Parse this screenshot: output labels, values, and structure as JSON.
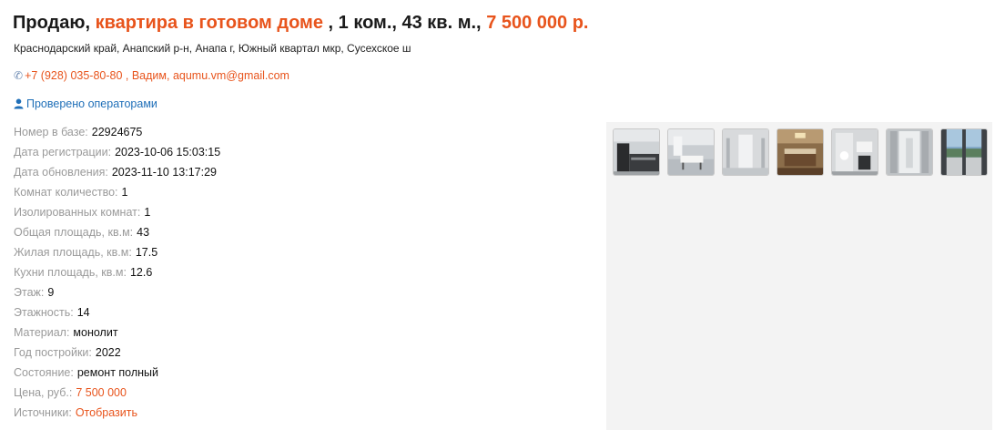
{
  "listing": {
    "title_prefix": "Продаю,",
    "title_type": "квартира в готовом доме",
    "title_rooms": "1 ком., 43 кв. м.,",
    "title_price": "7 500 000 р.",
    "address": "Краснодарский край, Анапский р-н, Анапа г, Южный квартал мкр, Сусехское ш",
    "contact": "+7 (928) 035-80-80 , Вадим, aqumu.vm@gmail.com",
    "verified": "Проверено операторами"
  },
  "properties": [
    {
      "label": "Номер в базе:",
      "value": "22924675"
    },
    {
      "label": "Дата регистрации:",
      "value": "2023-10-06 15:03:15"
    },
    {
      "label": "Дата обновления:",
      "value": "2023-11-10 13:17:29"
    },
    {
      "label": "Комнат количество:",
      "value": "1"
    },
    {
      "label": "Изолированных комнат:",
      "value": "1"
    },
    {
      "label": "Общая площадь, кв.м:",
      "value": "43"
    },
    {
      "label": "Жилая площадь, кв.м:",
      "value": "17.5"
    },
    {
      "label": "Кухни площадь, кв.м:",
      "value": "12.6"
    },
    {
      "label": "Этаж:",
      "value": "9"
    },
    {
      "label": "Этажность:",
      "value": "14"
    },
    {
      "label": "Материал:",
      "value": "монолит"
    },
    {
      "label": "Год постройки:",
      "value": "2022"
    },
    {
      "label": "Состояние:",
      "value": "ремонт полный"
    },
    {
      "label": "Цена, руб.:",
      "value": "7 500 000"
    },
    {
      "label": "Источники:",
      "value": "Отобразить"
    }
  ],
  "icons": {
    "phone": "phone-icon",
    "verified": "user-check-icon"
  },
  "colors": {
    "accent": "#e8541c",
    "verified": "#1f6fb8",
    "label": "#9a9a9a",
    "gallery_bg": "#f3f3f3"
  }
}
